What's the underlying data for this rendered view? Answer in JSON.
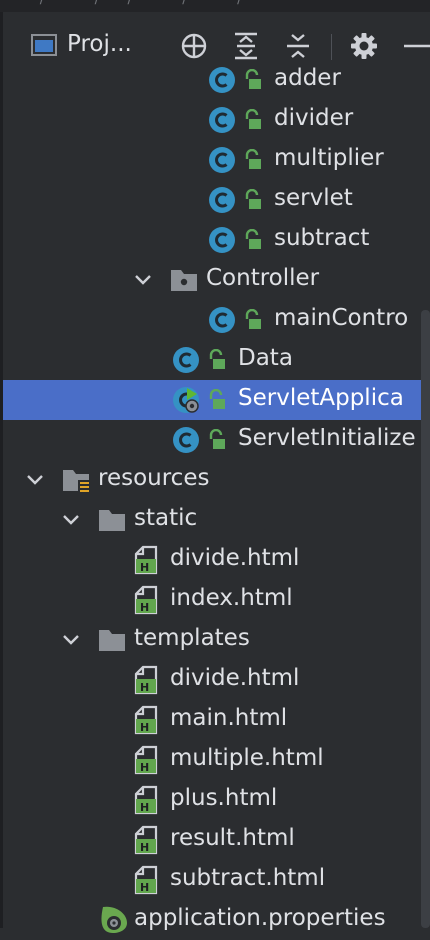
{
  "window": {
    "breadcrumb_fragment": "· · / · · · · / · · / · · · · / · · · · / · ·"
  },
  "header": {
    "project_label": "Proj...",
    "buttons": [
      {
        "name": "locate-icon"
      },
      {
        "name": "expand-all-icon"
      },
      {
        "name": "collapse-all-icon"
      },
      {
        "name": "gear-icon"
      },
      {
        "name": "hide-icon"
      }
    ]
  },
  "colors": {
    "class_icon": "#3592c4",
    "lock_green": "#5ea85a",
    "selection": "#4a6ec8",
    "html_green": "#62a64e"
  },
  "tree": [
    {
      "label": "adder",
      "kind": "class",
      "locked": true
    },
    {
      "label": "divider",
      "kind": "class",
      "locked": true
    },
    {
      "label": "multiplier",
      "kind": "class",
      "locked": true
    },
    {
      "label": "servlet",
      "kind": "class",
      "locked": true
    },
    {
      "label": "subtract",
      "kind": "class",
      "locked": true
    },
    {
      "label": "Controller",
      "kind": "package",
      "expanded": true
    },
    {
      "label": "mainContro",
      "kind": "class",
      "locked": true
    },
    {
      "label": "Data",
      "kind": "class",
      "locked": true
    },
    {
      "label": "ServletApplica",
      "kind": "spring-class",
      "locked": true,
      "selected": true
    },
    {
      "label": "ServletInitialize",
      "kind": "class",
      "locked": true
    },
    {
      "label": "resources",
      "kind": "resources-folder",
      "expanded": true
    },
    {
      "label": "static",
      "kind": "folder",
      "expanded": true
    },
    {
      "label": "divide.html",
      "kind": "html"
    },
    {
      "label": "index.html",
      "kind": "html"
    },
    {
      "label": "templates",
      "kind": "folder",
      "expanded": true
    },
    {
      "label": "divide.html",
      "kind": "html"
    },
    {
      "label": "main.html",
      "kind": "html"
    },
    {
      "label": "multiple.html",
      "kind": "html"
    },
    {
      "label": "plus.html",
      "kind": "html"
    },
    {
      "label": "result.html",
      "kind": "html"
    },
    {
      "label": "subtract.html",
      "kind": "html"
    },
    {
      "label": "application.properties",
      "kind": "properties"
    }
  ]
}
